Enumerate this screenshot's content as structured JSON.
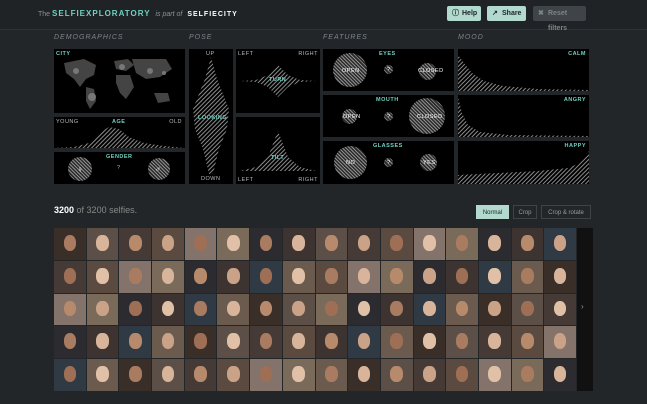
{
  "header": {
    "the": "The",
    "name": "SELFIEXPLORATORY",
    "is_part_of": "is part of",
    "parent": "SELFIECITY",
    "help": "Help",
    "share": "Share",
    "reset": "Reset filters"
  },
  "sections": {
    "demographics": "DEMOGRAPHICS",
    "pose": "POSE",
    "features": "FEATURES",
    "mood": "MOOD"
  },
  "demographics": {
    "city": "CITY",
    "age": "AGE",
    "young": "YOUNG",
    "old": "OLD",
    "gender": "GENDER",
    "unknown": "?"
  },
  "pose": {
    "up": "UP",
    "down": "DOWN",
    "looking": "LOOKING",
    "left": "LEFT",
    "right": "RIGHT",
    "turn": "TURN",
    "tilt": "TILT"
  },
  "features": {
    "eyes": {
      "label": "EYES",
      "a": "OPEN",
      "b": "CLOSED",
      "u": "?"
    },
    "mouth": {
      "label": "MOUTH",
      "a": "OPEN",
      "b": "CLOSED",
      "u": "?"
    },
    "glasses": {
      "label": "GLASSES",
      "a": "NO",
      "b": "YES",
      "u": "?"
    }
  },
  "mood": {
    "calm": "CALM",
    "angry": "ANGRY",
    "happy": "HAPPY"
  },
  "summary": {
    "count": "3200",
    "total_text": "of 3200 selfies."
  },
  "view_modes": {
    "normal": "Normal",
    "crop": "Crop",
    "crop_rotate": "Crop & rotate",
    "active": "Normal"
  },
  "colors": {
    "accent": "#6fd1c2",
    "button": "#b2d9ce"
  },
  "grid": {
    "rows": 5,
    "cols": 16
  },
  "pager": {
    "next": "›"
  }
}
